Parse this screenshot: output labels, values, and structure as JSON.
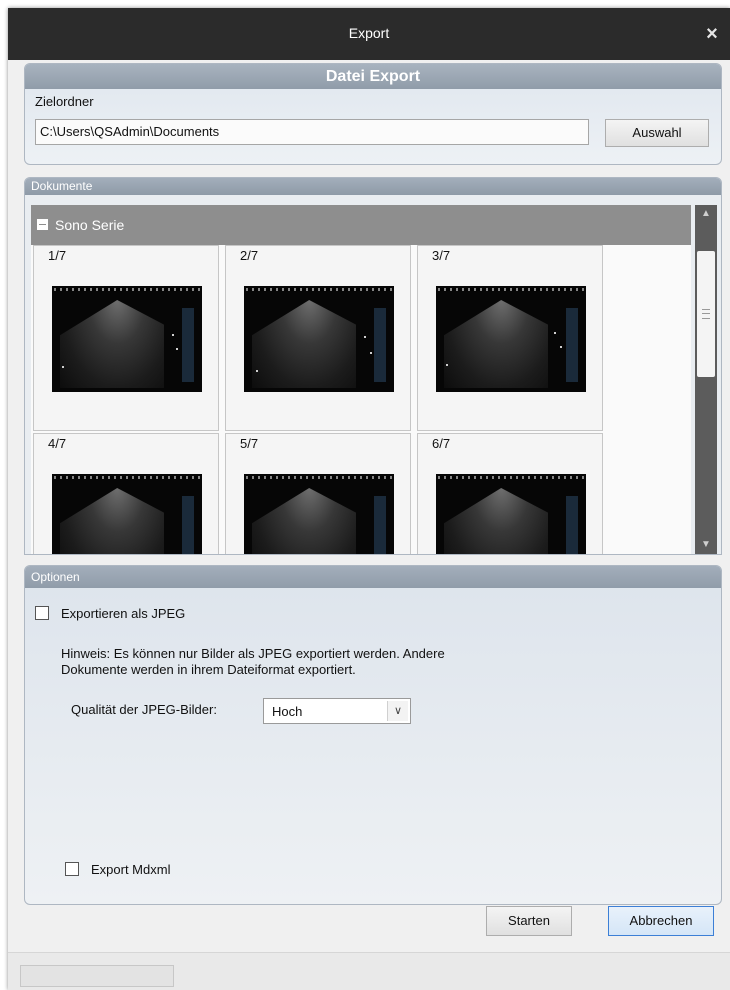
{
  "window": {
    "title": "Export",
    "close_glyph": "×"
  },
  "datei_export": {
    "header": "Datei Export",
    "target_label": "Zielordner",
    "target_path": "C:\\Users\\QSAdmin\\Documents",
    "browse_button": "Auswahl"
  },
  "documents": {
    "header": "Dokumente",
    "group": {
      "name": "Sono Serie",
      "collapse_icon": "minus-icon"
    },
    "thumbnails": [
      {
        "label": "1/7"
      },
      {
        "label": "2/7"
      },
      {
        "label": "3/7"
      },
      {
        "label": "4/7"
      },
      {
        "label": "5/7"
      },
      {
        "label": "6/7"
      }
    ],
    "scrollbar": {
      "up_glyph": "▲",
      "down_glyph": "▼"
    }
  },
  "options": {
    "header": "Optionen",
    "export_jpeg": {
      "label": "Exportieren als JPEG",
      "checked": false
    },
    "hint_line1": "Hinweis: Es können nur Bilder als JPEG exportiert werden. Andere",
    "hint_line2": "Dokumente werden in ihrem Dateiformat  exportiert.",
    "quality_label": "Qualität der JPEG-Bilder:",
    "quality_value": "Hoch",
    "export_mdxml": {
      "label": "Export Mdxml",
      "checked": false
    }
  },
  "footer": {
    "start_button": "Starten",
    "cancel_button": "Abbrechen"
  }
}
